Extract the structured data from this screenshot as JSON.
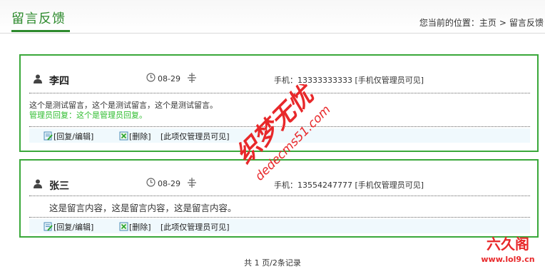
{
  "header": {
    "title": "留言反馈",
    "breadcrumb_prefix": "您当前的位置：",
    "breadcrumb_home": "主页",
    "breadcrumb_sep": ">",
    "breadcrumb_current": "留言反馈"
  },
  "messages": [
    {
      "user": "李四",
      "date": "08-29",
      "phone": "手机：13333333333 [手机仅管理员可见]",
      "content": "这个是测试留言，这个是测试留言，这个是测试留言。",
      "admin_reply": "管理员回复：这个是管理员回复。",
      "reply_edit": "[回复/编辑]",
      "delete": "[删除]",
      "admin_only": "[此项仅管理员可见]"
    },
    {
      "user": "张三",
      "date": "08-29",
      "phone": "手机：13554247777 [手机仅管理员可见]",
      "content": "这是留言内容，这是留言内容，这是留言内容。",
      "reply_edit": "[回复/编辑]",
      "delete": "[删除]",
      "admin_only": "[此项仅管理员可见]"
    }
  ],
  "pagination": {
    "text": "共 1 页/2条记录"
  },
  "watermark": {
    "brand": "织梦无忧",
    "url": "dedecms51.com"
  },
  "logo": {
    "name": "六久阁",
    "url": "www.lol9.cn"
  },
  "colors": {
    "accent": "#2d8a2d",
    "border": "#3aa83a",
    "reply": "#2fbd2f",
    "watermark": "#e8282a"
  }
}
